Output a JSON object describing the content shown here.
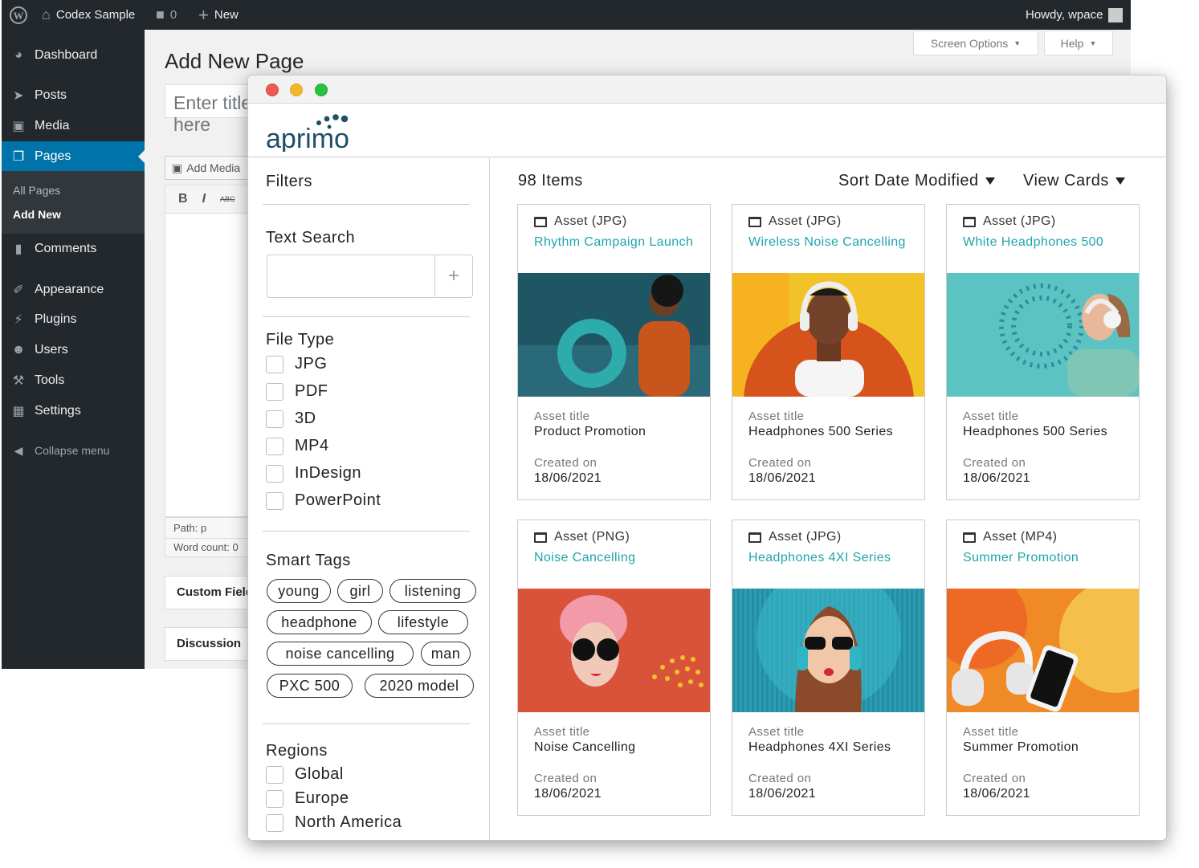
{
  "wp": {
    "adminbar": {
      "site": "Codex Sample",
      "comments": "0",
      "new": "New",
      "howdy": "Howdy, wpace"
    },
    "menu": [
      {
        "label": "Dashboard",
        "icon": "dashboard-icon"
      },
      {
        "label": "Posts",
        "icon": "pin-icon"
      },
      {
        "label": "Media",
        "icon": "media-icon"
      },
      {
        "label": "Pages",
        "icon": "pages-icon"
      },
      {
        "label": "Comments",
        "icon": "comment-icon"
      },
      {
        "label": "Appearance",
        "icon": "brush-icon"
      },
      {
        "label": "Plugins",
        "icon": "plug-icon"
      },
      {
        "label": "Users",
        "icon": "user-icon"
      },
      {
        "label": "Tools",
        "icon": "wrench-icon"
      },
      {
        "label": "Settings",
        "icon": "settings-icon"
      },
      {
        "label": "Collapse menu",
        "icon": "collapse-icon"
      }
    ],
    "submenu": [
      "All Pages",
      "Add New"
    ],
    "screen_options": "Screen Options",
    "help": "Help",
    "page_title": "Add New Page",
    "title_placeholder": "Enter title here",
    "add_media": "Add Media",
    "toolbar": {
      "bold": "B",
      "italic": "I",
      "strike": "ABC"
    },
    "path": "Path: p",
    "word_count": "Word count: 0",
    "custom_fields": "Custom Fields",
    "discussion": "Discussion"
  },
  "aprimo": {
    "logo": "aprimo",
    "brand_color": "#1f4e66",
    "accent_color": "#1fa5ad",
    "filters": {
      "title": "Filters",
      "text_search": "Text Search",
      "file_type_title": "File Type",
      "file_types": [
        "JPG",
        "PDF",
        "3D",
        "MP4",
        "InDesign",
        "PowerPoint"
      ],
      "smart_tags_title": "Smart Tags",
      "tags": [
        "young",
        "girl",
        "listening",
        "headphone",
        "lifestyle",
        "noise cancelling",
        "man",
        "PXC 500",
        "2020 model"
      ],
      "regions_title": "Regions",
      "regions": [
        "Global",
        "Europe",
        "North America"
      ]
    },
    "count": "98 Items",
    "sort": "Sort Date Modified",
    "view": "View Cards",
    "asset_title_label": "Asset title",
    "created_on_label": "Created on",
    "cards": [
      {
        "type": "Asset (JPG)",
        "name": "Rhythm Campaign Launch",
        "title": "Product Promotion",
        "date": "18/06/2021"
      },
      {
        "type": "Asset (JPG)",
        "name": "Wireless Noise Cancelling",
        "title": "Headphones 500 Series",
        "date": "18/06/2021"
      },
      {
        "type": "Asset (JPG)",
        "name": "White Headphones 500",
        "title": "Headphones 500 Series",
        "date": "18/06/2021"
      },
      {
        "type": "Asset (PNG)",
        "name": "Noise Cancelling",
        "title": "Noise Cancelling",
        "date": "18/06/2021"
      },
      {
        "type": "Asset (JPG)",
        "name": "Headphones 4XI Series",
        "title": "Headphones 4XI Series",
        "date": "18/06/2021"
      },
      {
        "type": "Asset (MP4)",
        "name": "Summer Promotion",
        "title": "Summer Promotion",
        "date": "18/06/2021"
      }
    ]
  }
}
